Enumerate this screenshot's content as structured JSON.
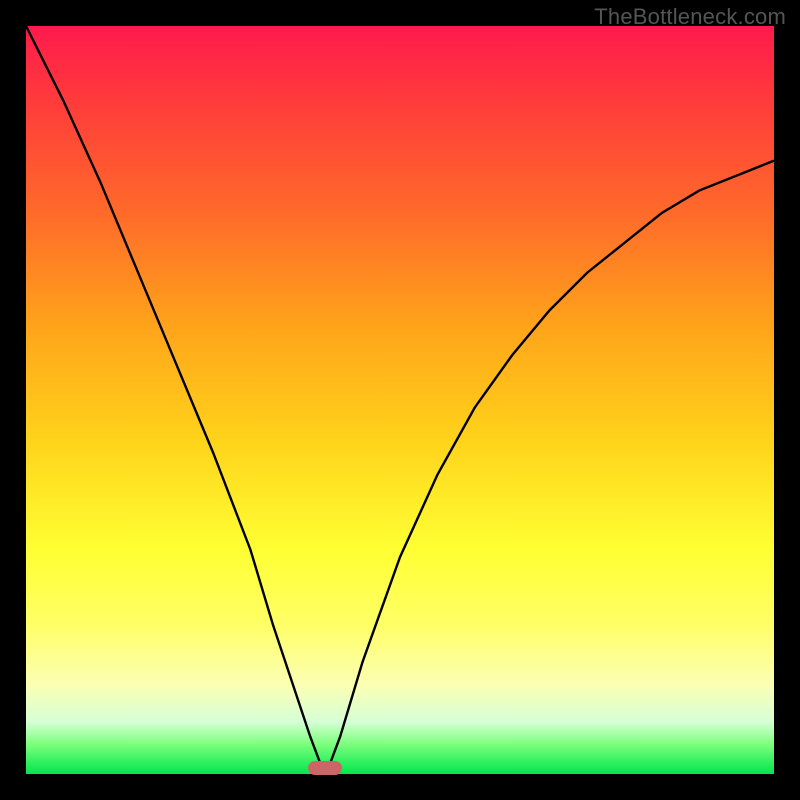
{
  "watermark": "TheBottleneck.com",
  "colors": {
    "background": "#000000",
    "curve": "#000000",
    "marker": "#cc6666"
  },
  "chart_data": {
    "type": "line",
    "title": "",
    "xlabel": "",
    "ylabel": "",
    "xlim": [
      0,
      100
    ],
    "ylim": [
      0,
      100
    ],
    "x": [
      0,
      5,
      10,
      15,
      20,
      25,
      30,
      33,
      36,
      38,
      39.5,
      40,
      40.5,
      42,
      45,
      50,
      55,
      60,
      65,
      70,
      75,
      80,
      85,
      90,
      95,
      100
    ],
    "values": [
      100,
      90,
      79,
      67,
      55,
      43,
      30,
      20,
      11,
      5,
      1,
      0,
      1,
      5,
      15,
      29,
      40,
      49,
      56,
      62,
      67,
      71,
      75,
      78,
      80,
      82
    ],
    "marker_x": 40,
    "marker_y": 0,
    "grid": false,
    "legend": null,
    "annotations": [
      "TheBottleneck.com"
    ]
  }
}
